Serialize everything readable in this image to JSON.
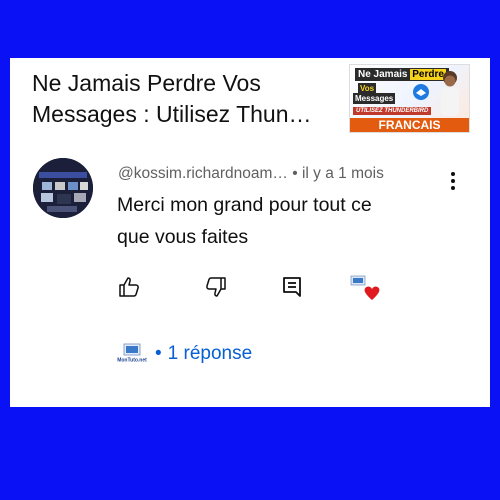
{
  "video": {
    "title": "Ne Jamais Perdre Vos\nMessages : Utilisez Thun…",
    "thumbnail": {
      "line1_a": "Ne Jamais",
      "line1_b": "Perdre",
      "line2": "Vos",
      "line3": "Messages",
      "line4": "UTILISEZ THUNDERBIRD",
      "line5": "FRANCAIS"
    }
  },
  "comment": {
    "handle": "@kossim.richardnoam…",
    "separator": "•",
    "time": "il y a 1 mois",
    "text": "Merci mon grand pour tout ce\nque vous faites"
  },
  "actions": {
    "like_icon": "thumb-up-icon",
    "dislike_icon": "thumb-down-icon",
    "reply_icon": "reply-icon",
    "creator_heart_icon": "creator-heart-icon"
  },
  "replies": {
    "separator": "•",
    "count_label": "1 réponse",
    "logo_text": "MonTuto.net"
  },
  "colors": {
    "background": "#0a12f5",
    "card": "#ffffff",
    "link": "#065fd4",
    "heart": "#e0191f",
    "thumb_banner": "#e35b0e"
  }
}
